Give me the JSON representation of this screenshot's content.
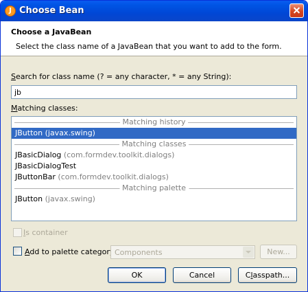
{
  "window": {
    "title": "Choose Bean",
    "icon": "java-cup-icon"
  },
  "header": {
    "title": "Choose a JavaBean",
    "description": "Select the class name of a JavaBean that you want to add to the form."
  },
  "search": {
    "label_mnemonic": "S",
    "label_rest": "earch for class name (? = any character, * = any String):",
    "value": "jb"
  },
  "matching": {
    "label_mnemonic": "M",
    "label_rest": "atching classes:",
    "sections": [
      {
        "title": "Matching history",
        "items": [
          {
            "name": "JButton",
            "pkg": "(javax.swing)",
            "selected": true
          }
        ]
      },
      {
        "title": "Matching classes",
        "items": [
          {
            "name": "JBasicDialog",
            "pkg": "(com.formdev.toolkit.dialogs)"
          },
          {
            "name": "JBasicDialogTest",
            "pkg": ""
          },
          {
            "name": "JButtonBar",
            "pkg": "(com.formdev.toolkit.dialogs)"
          }
        ]
      },
      {
        "title": "Matching palette",
        "items": [
          {
            "name": "JButton",
            "pkg": "(javax.swing)"
          }
        ]
      }
    ]
  },
  "is_container": {
    "label_mnemonic": "I",
    "label_rest": "s container",
    "checked": false,
    "enabled": false
  },
  "palette": {
    "label_mnemonic": "A",
    "label_rest": "dd to palette category:",
    "checked": false,
    "category": "Components",
    "new_label": "New..."
  },
  "buttons": {
    "ok": "OK",
    "cancel": "Cancel",
    "classpath_mnemonic": "l",
    "classpath_pre": "C",
    "classpath_post": "asspath..."
  }
}
